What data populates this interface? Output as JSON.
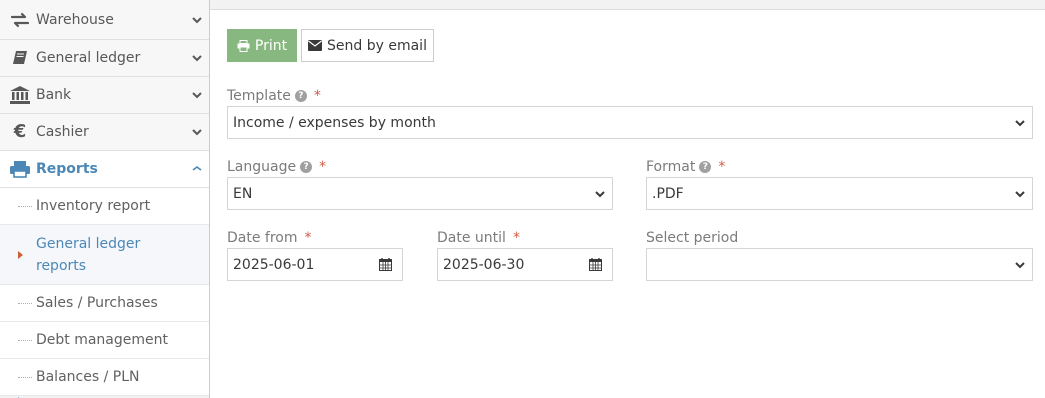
{
  "sidebar": {
    "items": [
      {
        "label": "Warehouse",
        "icon": "exchange-icon"
      },
      {
        "label": "General ledger",
        "icon": "book-icon"
      },
      {
        "label": "Bank",
        "icon": "bank-icon"
      },
      {
        "label": "Cashier",
        "icon": "euro-icon",
        "glyph": "€"
      },
      {
        "label": "Reports",
        "icon": "print-icon",
        "active": true
      }
    ],
    "submenu": [
      {
        "label": "Inventory report"
      },
      {
        "label": "General ledger reports",
        "active": true
      },
      {
        "label": "Sales / Purchases"
      },
      {
        "label": "Debt management"
      },
      {
        "label": "Balances / PLN"
      }
    ]
  },
  "toolbar": {
    "print_label": "Print",
    "email_label": "Send by email"
  },
  "form": {
    "template": {
      "label": "Template",
      "value": "Income / expenses by month",
      "required": "*",
      "help": "?"
    },
    "language": {
      "label": "Language",
      "value": "EN",
      "required": "*",
      "help": "?"
    },
    "format": {
      "label": "Format",
      "value": ".PDF",
      "required": "*",
      "help": "?"
    },
    "date_from": {
      "label": "Date from",
      "value": "2025-06-01",
      "required": "*"
    },
    "date_until": {
      "label": "Date until",
      "value": "2025-06-30",
      "required": "*"
    },
    "select_period": {
      "label": "Select period",
      "value": ""
    }
  },
  "colors": {
    "accent": "#4b88b7",
    "print_button": "#87b87f",
    "required": "#d15b47",
    "active_marker": "#c86139"
  }
}
